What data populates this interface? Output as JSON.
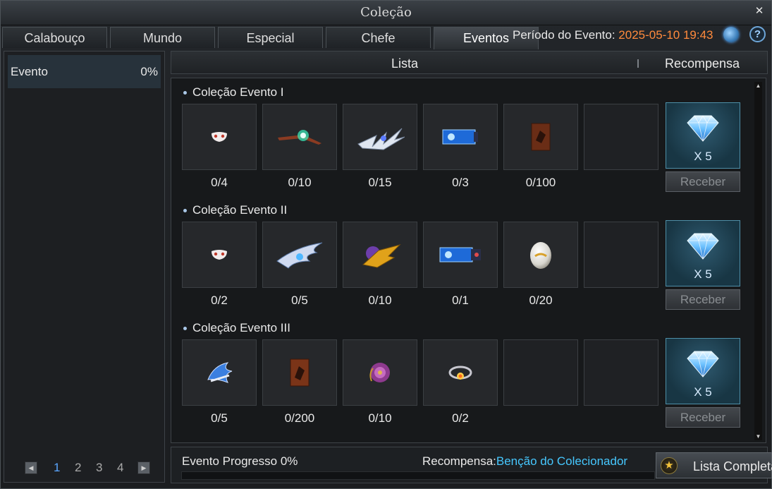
{
  "window": {
    "title": "Coleção",
    "close_icon": "close-icon"
  },
  "tabs": [
    {
      "label": "Calabouço",
      "active": false
    },
    {
      "label": "Mundo",
      "active": false
    },
    {
      "label": "Especial",
      "active": false
    },
    {
      "label": "Chefe",
      "active": false
    },
    {
      "label": "Eventos",
      "active": true
    }
  ],
  "event_period": {
    "label": "Período do Evento:",
    "value": "2025-05-10 19:43"
  },
  "help": {
    "label": "?"
  },
  "sidebar": {
    "categories": [
      {
        "name": "Evento",
        "percent": "0%"
      }
    ],
    "pager": {
      "pages": [
        "1",
        "2",
        "3",
        "4"
      ],
      "current": "1"
    }
  },
  "list_header": {
    "list_label": "Lista",
    "reward_label": "Recompensa"
  },
  "collections": [
    {
      "title": "Coleção Evento I",
      "items": [
        {
          "icon": "mask-icon",
          "count": "0/4"
        },
        {
          "icon": "glowing-crossbow-icon",
          "count": "0/10"
        },
        {
          "icon": "silver-wing-icon",
          "count": "0/15"
        },
        {
          "icon": "blue-scroll-icon",
          "count": "0/3"
        },
        {
          "icon": "brown-card-icon",
          "count": "0/100"
        }
      ],
      "reward": {
        "icon": "diamond-icon",
        "quantity": "X 5",
        "button": "Receber"
      }
    },
    {
      "title": "Coleção Evento II",
      "items": [
        {
          "icon": "mask-icon",
          "count": "0/2"
        },
        {
          "icon": "blue-blade-icon",
          "count": "0/5"
        },
        {
          "icon": "golden-weapon-icon",
          "count": "0/10"
        },
        {
          "icon": "blue-scroll-icon",
          "count": "0/1"
        },
        {
          "icon": "egg-icon",
          "count": "0/20"
        }
      ],
      "reward": {
        "icon": "diamond-icon",
        "quantity": "X 5",
        "button": "Receber"
      }
    },
    {
      "title": "Coleção Evento III",
      "items": [
        {
          "icon": "blue-dragon-icon",
          "count": "0/5"
        },
        {
          "icon": "brown-card-icon",
          "count": "0/200"
        },
        {
          "icon": "purple-flower-icon",
          "count": "0/10"
        },
        {
          "icon": "ring-icon",
          "count": "0/2"
        }
      ],
      "reward": {
        "icon": "diamond-icon",
        "quantity": "X 5",
        "button": "Receber"
      }
    }
  ],
  "footer": {
    "progress_text": "Evento Progresso 0%",
    "progress_fraction": 0,
    "reward_label": "Recompensa:",
    "reward_name": "Benção do Colecionador",
    "full_list_button": "Lista Completa"
  },
  "colors": {
    "date": "#ff8a3c",
    "reward_name": "#46c8ff",
    "active_page": "#5aa6ff"
  }
}
